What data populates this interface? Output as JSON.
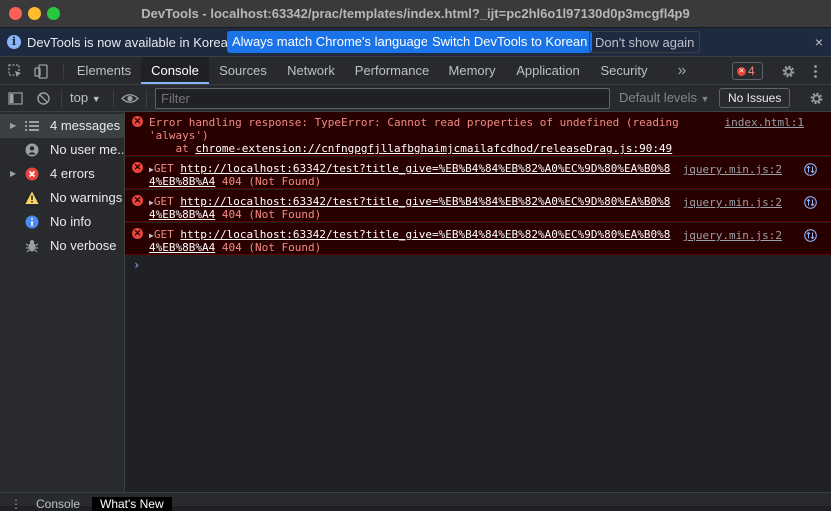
{
  "window": {
    "title": "DevTools - localhost:63342/prac/templates/index.html?_ijt=pc2hl6o1l97130d0p3mcgfl4p9"
  },
  "infobar": {
    "message": "DevTools is now available in Korean!",
    "btn_match": "Always match Chrome's language",
    "btn_switch": "Switch DevTools to Korean",
    "btn_dismiss": "Don't show again",
    "close": "×"
  },
  "tabs": [
    {
      "label": "Elements"
    },
    {
      "label": "Console"
    },
    {
      "label": "Sources"
    },
    {
      "label": "Network"
    },
    {
      "label": "Performance"
    },
    {
      "label": "Memory"
    },
    {
      "label": "Application"
    },
    {
      "label": "Security"
    }
  ],
  "more_tabs": "»",
  "error_count": "4",
  "filterbar": {
    "context": "top",
    "filter_placeholder": "Filter",
    "levels": "Default levels",
    "no_issues": "No Issues"
  },
  "sidebar": {
    "items": [
      {
        "label": "4 messages",
        "icon": "list-icon"
      },
      {
        "label": "No user me...",
        "icon": "user-icon"
      },
      {
        "label": "4 errors",
        "icon": "error-icon"
      },
      {
        "label": "No warnings",
        "icon": "warning-icon"
      },
      {
        "label": "No info",
        "icon": "info-icon"
      },
      {
        "label": "No verbose",
        "icon": "bug-icon"
      }
    ]
  },
  "messages": [
    {
      "line1": "Error handling response: TypeError: Cannot read properties of undefined (reading",
      "line2": "'always')",
      "line3_prefix": "    at ",
      "line3_link": "chrome-extension://cnfngpgfjllafbghaimjcmailafcdhod/releaseDrag.js:90:49",
      "source": "index.html:1"
    },
    {
      "prefix": "GET ",
      "url1": "http://localhost:63342/test?title_give=%EB%B4%84%EB%82%A0%EC%9D%80%EA%B0%8",
      "url2": "4%EB%8B%A4",
      "status": " 404 (Not Found)",
      "source": "jquery.min.js:2"
    },
    {
      "prefix": "GET ",
      "url1": "http://localhost:63342/test?title_give=%EB%B4%84%EB%82%A0%EC%9D%80%EA%B0%8",
      "url2": "4%EB%8B%A4",
      "status": " 404 (Not Found)",
      "source": "jquery.min.js:2"
    },
    {
      "prefix": "GET ",
      "url1": "http://localhost:63342/test?title_give=%EB%B4%84%EB%82%A0%EC%9D%80%EA%B0%8",
      "url2": "4%EB%8B%A4",
      "status": " 404 (Not Found)",
      "source": "jquery.min.js:2"
    }
  ],
  "prompt": "›",
  "drawer": {
    "tab_console": "Console",
    "tab_whatsnew": "What's New"
  },
  "colors": {
    "accent": "#8ab4f8",
    "error_text": "#f28b82",
    "error_bg": "#290000",
    "primary_button": "#1a73e8"
  }
}
